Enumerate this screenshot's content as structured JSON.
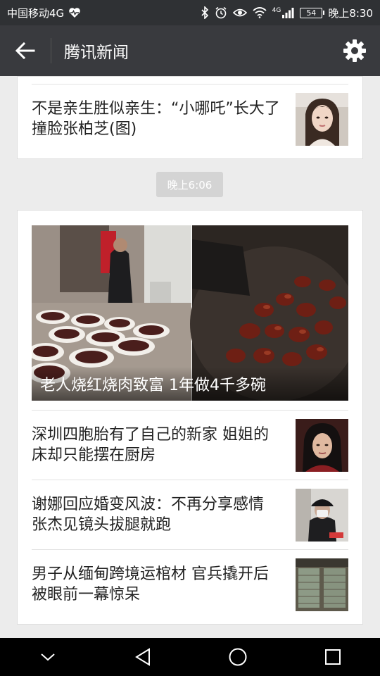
{
  "status_bar": {
    "carrier": "中国移动4G",
    "network_sup": "4G",
    "battery": "54",
    "time": "晚上8:30"
  },
  "app_bar": {
    "title": "腾讯新闻"
  },
  "card_top": {
    "items": [
      {
        "title": "不是亲生胜似亲生：“小哪吒”长大了撞脸张柏芝(图)"
      }
    ]
  },
  "time_divider": "晚上6:06",
  "card_main": {
    "hero": {
      "caption": "老人烧红烧肉致富 1年做4千多碗"
    },
    "items": [
      {
        "title": "深圳四胞胎有了自己的新家 姐姐的床却只能摆在厨房"
      },
      {
        "title": "谢娜回应婚变风波：不再分享感情 张杰见镜头拔腿就跑"
      },
      {
        "title": "男子从缅甸跨境运棺材 官兵撬开后被眼前一幕惊呆"
      }
    ]
  },
  "colors": {
    "status_bar_bg": "#2f3134",
    "app_bar_bg": "#393a3e",
    "page_bg": "#ececec",
    "nav_bar_bg": "#000000"
  }
}
